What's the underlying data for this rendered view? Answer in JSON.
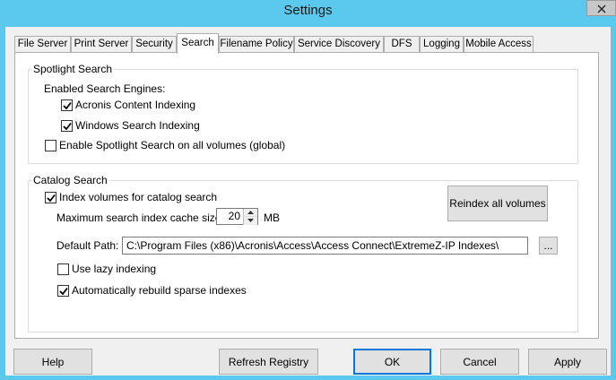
{
  "window": {
    "title": "Settings"
  },
  "tabs": [
    {
      "label": "File Server"
    },
    {
      "label": "Print Server"
    },
    {
      "label": "Security"
    },
    {
      "label": "Search",
      "active": true
    },
    {
      "label": "Filename Policy"
    },
    {
      "label": "Service Discovery"
    },
    {
      "label": "DFS"
    },
    {
      "label": "Logging"
    },
    {
      "label": "Mobile Access"
    }
  ],
  "spotlight": {
    "group_label": "Spotlight Search",
    "engines_label": "Enabled Search Engines:",
    "acronis": {
      "label": "Acronis Content Indexing",
      "checked": true
    },
    "windows": {
      "label": "Windows Search Indexing",
      "checked": true
    },
    "global": {
      "label": "Enable Spotlight Search on all volumes (global)",
      "checked": false
    }
  },
  "catalog": {
    "group_label": "Catalog Search",
    "index_volumes": {
      "label": "Index volumes for catalog search",
      "checked": true
    },
    "cache_label": "Maximum search index cache size",
    "cache_value": "20",
    "cache_unit": "MB",
    "reindex_label": "Reindex all volumes",
    "default_path_label": "Default Path:",
    "default_path_value": "C:\\Program Files (x86)\\Acronis\\Access\\Access Connect\\ExtremeZ-IP Indexes\\",
    "browse_label": "...",
    "lazy": {
      "label": "Use lazy indexing",
      "checked": false
    },
    "rebuild": {
      "label": "Automatically rebuild sparse indexes",
      "checked": true
    }
  },
  "buttons": {
    "help": "Help",
    "refresh": "Refresh Registry",
    "ok": "OK",
    "cancel": "Cancel",
    "apply": "Apply"
  },
  "colors": {
    "title_bar": "#5bc8ee",
    "default_button_border": "#0078d7"
  }
}
